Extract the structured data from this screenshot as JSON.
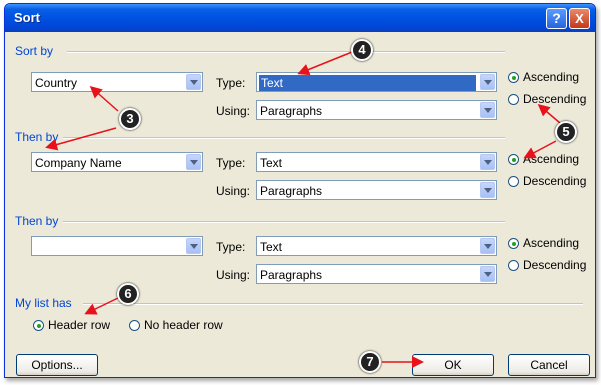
{
  "window": {
    "title": "Sort"
  },
  "titlebar_buttons": {
    "help": "?",
    "close": "X"
  },
  "sort_by": {
    "label": "Sort by",
    "field": "Country",
    "type_label": "Type:",
    "type_value": "Text",
    "using_label": "Using:",
    "using_value": "Paragraphs",
    "ascending": "Ascending",
    "descending": "Descending"
  },
  "then_by_1": {
    "label": "Then by",
    "field": "Company Name",
    "type_label": "Type:",
    "type_value": "Text",
    "using_label": "Using:",
    "using_value": "Paragraphs",
    "ascending": "Ascending",
    "descending": "Descending"
  },
  "then_by_2": {
    "label": "Then by",
    "field": "",
    "type_label": "Type:",
    "type_value": "Text",
    "using_label": "Using:",
    "using_value": "Paragraphs",
    "ascending": "Ascending",
    "descending": "Descending"
  },
  "my_list_has": {
    "label": "My list has",
    "header_row": "Header row",
    "no_header_row": "No header row"
  },
  "buttons": {
    "options": "Options...",
    "ok": "OK",
    "cancel": "Cancel"
  },
  "callouts": [
    "3",
    "4",
    "5",
    "6",
    "7"
  ],
  "colors": {
    "title_bar": "#0054e3",
    "dialog_bg": "#ece9d8",
    "callout_arrow": "#e8121b",
    "section_label": "#0046d5"
  }
}
